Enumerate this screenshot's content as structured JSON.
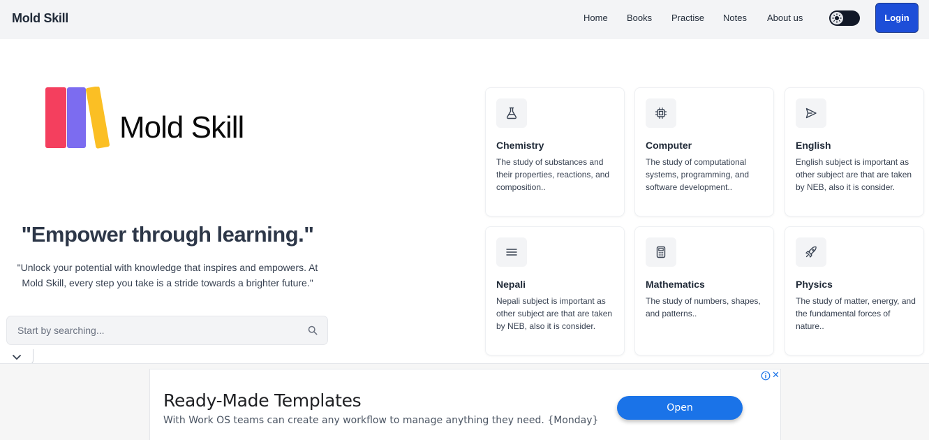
{
  "navbar": {
    "brand": "Mold Skill",
    "links": [
      "Home",
      "Books",
      "Practise",
      "Notes",
      "About us"
    ],
    "login_label": "Login"
  },
  "hero": {
    "logo_text": "Mold Skill",
    "title": "\"Empower through learning.\"",
    "subtitle": "\"Unlock your potential with knowledge that inspires and empowers. At Mold Skill, every step you take is a stride towards a brighter future.\"",
    "search_placeholder": "Start by searching..."
  },
  "subjects": [
    {
      "icon": "flask-icon",
      "title": "Chemistry",
      "description": "The study of substances and their properties, reactions, and composition.."
    },
    {
      "icon": "cpu-chip-icon",
      "title": "Computer",
      "description": "The study of computational systems, programming, and software development.."
    },
    {
      "icon": "paper-plane-icon",
      "title": "English",
      "description": "English subject is important as other subject are that are taken by NEB, also it is consider."
    },
    {
      "icon": "menu-lines-icon",
      "title": "Nepali",
      "description": "Nepali subject is important as other subject are that are taken by NEB, also it is consider."
    },
    {
      "icon": "calculator-icon",
      "title": "Mathematics",
      "description": "The study of numbers, shapes, and patterns.."
    },
    {
      "icon": "rocket-icon",
      "title": "Physics",
      "description": "The study of matter, energy, and the fundamental forces of nature.."
    }
  ],
  "ad": {
    "title": "Ready-Made Templates",
    "subtitle": "With Work OS teams can create any workflow to manage anything they need. {Monday}",
    "button_label": "Open",
    "close_glyph": "✕"
  },
  "colors": {
    "primary": "#1d4ed8",
    "book_red": "#f43f5e",
    "book_purple": "#7c6cf0",
    "book_yellow": "#fbbf24",
    "ad_button": "#1a73e8"
  }
}
